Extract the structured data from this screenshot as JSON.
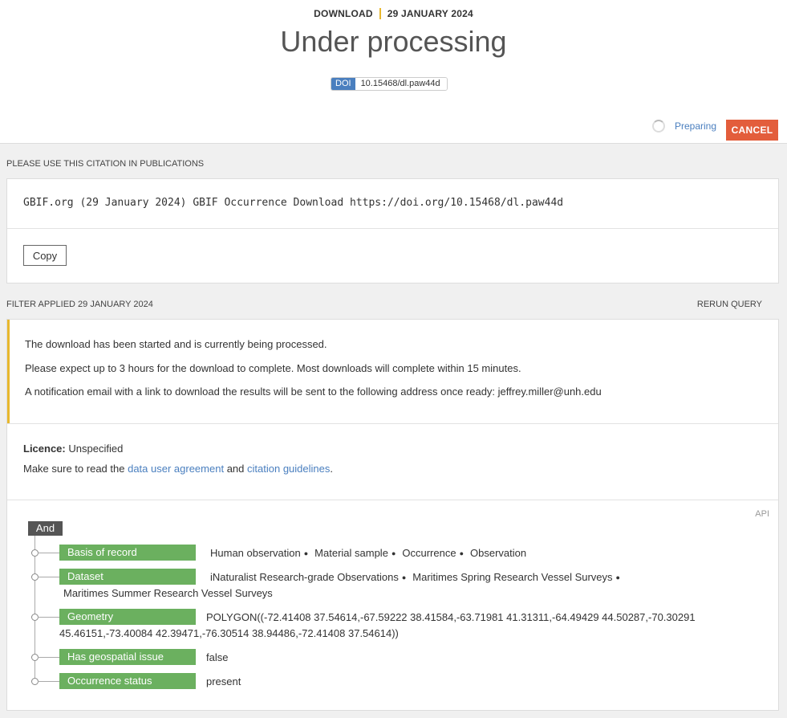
{
  "header": {
    "kicker_left": "DOWNLOAD",
    "kicker_right": "29 JANUARY 2024",
    "title": "Under processing",
    "doi_tag": "DOI",
    "doi_value": "10.15468/dl.paw44d",
    "status_text": "Preparing",
    "cancel_label": "CANCEL"
  },
  "citation_section": {
    "label": "PLEASE USE THIS CITATION IN PUBLICATIONS",
    "citation": "GBIF.org (29 January 2024) GBIF Occurrence Download https://doi.org/10.15468/dl.paw44d",
    "copy_label": "Copy"
  },
  "filter_section": {
    "label": "FILTER APPLIED 29 JANUARY 2024",
    "rerun_label": "RERUN QUERY",
    "messages": [
      "The download has been started and is currently being processed.",
      "Please expect up to 3 hours for the download to complete. Most downloads will complete within 15 minutes.",
      "A notification email with a link to download the results will be sent to the following address once ready: jeffrey.miller@unh.edu"
    ],
    "licence_label": "Licence:",
    "licence_value": "Unspecified",
    "agreement_prefix": "Make sure to read the",
    "agreement_link": "data user agreement",
    "agreement_and": "and",
    "citation_link": "citation guidelines",
    "agreement_suffix": "."
  },
  "query": {
    "api_label": "API",
    "operator": "And",
    "filters": [
      {
        "key": "Basis of record",
        "values": [
          "Human observation",
          "Material sample",
          "Occurrence",
          "Observation"
        ]
      },
      {
        "key": "Dataset",
        "values": [
          "iNaturalist Research-grade Observations",
          "Maritimes Spring Research Vessel Surveys",
          "Maritimes Summer Research Vessel Surveys"
        ]
      },
      {
        "key": "Geometry",
        "values": [
          "POLYGON((-72.41408 37.54614,-67.59222 38.41584,-63.71981 41.31311,-64.49429 44.50287,-70.30291",
          "45.46151,-73.40084 42.39471,-76.30514 38.94486,-72.41408 37.54614))"
        ]
      },
      {
        "key": "Has geospatial issue",
        "values": [
          "false"
        ]
      },
      {
        "key": "Occurrence status",
        "values": [
          "present"
        ]
      }
    ]
  }
}
